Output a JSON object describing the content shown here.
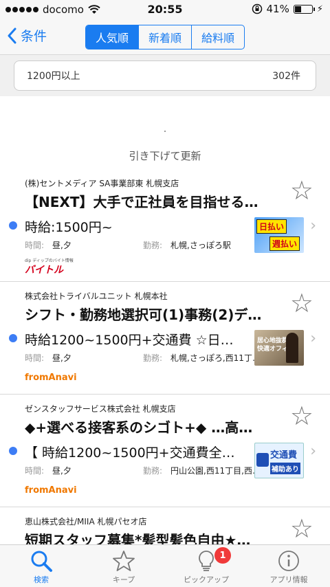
{
  "status_bar": {
    "carrier": "docomo",
    "time": "20:55",
    "battery": "41%",
    "battery_level": 0.41
  },
  "nav": {
    "back_label": "条件",
    "sort_tabs": [
      {
        "label": "人気順",
        "active": true
      },
      {
        "label": "新着順",
        "active": false
      },
      {
        "label": "給料順",
        "active": false
      }
    ]
  },
  "filter": {
    "condition": "1200円以上",
    "count": "302件"
  },
  "refresh_hint": "引き下げて更新",
  "jobs": [
    {
      "company": "(株)セントメディア SA事業部東 札幌支店",
      "title": "【NEXT】大手で正社員を目指せる…",
      "wage": "時給:1500円~",
      "time_key": "時間:",
      "time": "昼,夕",
      "place_key": "勤務:",
      "place": "札幌,さっぽろ駅",
      "thumb_text_1": "日払い",
      "thumb_text_2": "週払い",
      "source_small": "dip ディップのバイト情報",
      "source": "バイトル"
    },
    {
      "company": "株式会社トライバルユニット 札幌本社",
      "title": "シフト・勤務地選択可(1)事務(2)デ…",
      "wage": "時給1200~1500円+交通費 ☆日…",
      "time_key": "時間:",
      "time": "昼,夕",
      "place_key": "勤務:",
      "place": "札幌,さっぽろ,西11丁…",
      "thumb_text_1": "居心地抜群!",
      "thumb_text_2": "快適オフィス",
      "source": "fromAnavi"
    },
    {
      "company": "ゼンスタッフサービス株式会社 札幌支店",
      "title": "◆+選べる接客系のシゴト+◆ …高…",
      "wage": "【 時給1200~1500円+交通費全…",
      "time_key": "時間:",
      "time": "昼,夕",
      "place_key": "勤務:",
      "place": "円山公園,西11丁目,西…",
      "thumb_text_1": "交通費",
      "thumb_text_2": "補助あり",
      "source": "fromAnavi"
    },
    {
      "company": "恵山株式会社/MIIA 札幌パセオ店",
      "title": "短期スタッフ募集*髪型髪色自由★…"
    }
  ],
  "tabbar": {
    "tabs": [
      {
        "label": "検索",
        "icon": "search-icon",
        "active": true
      },
      {
        "label": "キープ",
        "icon": "star-icon",
        "active": false
      },
      {
        "label": "ピックアップ",
        "icon": "lightbulb-icon",
        "active": false
      },
      {
        "label": "アプリ情報",
        "icon": "info-icon",
        "active": false
      }
    ],
    "pickup_badge": "1"
  },
  "colors": {
    "accent": "#1a7cf0",
    "badge": "#f03a3a",
    "unread_dot": "#3d7df5"
  }
}
